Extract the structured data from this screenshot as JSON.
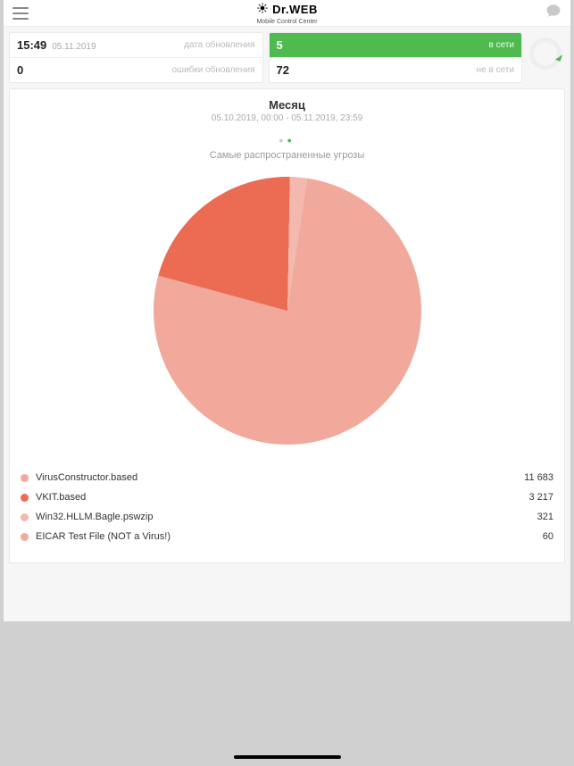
{
  "brand": {
    "name": "Dr.WEB",
    "subtitle": "Mobile Control Center"
  },
  "stats": {
    "update": {
      "time": "15:49",
      "date": "05.11.2019",
      "label": "дата обновления"
    },
    "errors": {
      "value": "0",
      "label": "ошибки обновления"
    },
    "online": {
      "value": "5",
      "label": "в сети"
    },
    "offline": {
      "value": "72",
      "label": "не в сети"
    }
  },
  "period": {
    "title": "Месяц",
    "range": "05.10.2019, 00:00 - 05.11.2019, 23:59"
  },
  "chart_title": "Самые распространенные угрозы",
  "chart_data": {
    "type": "pie",
    "title": "Самые распространенные угрозы",
    "series": [
      {
        "name": "VirusConstructor.based",
        "value": 11683,
        "display": "11 683",
        "color": "#f1a99c"
      },
      {
        "name": "VKIT.based",
        "value": 3217,
        "display": "3 217",
        "color": "#ec6b53"
      },
      {
        "name": "Win32.HLLM.Bagle.pswzip",
        "value": 321,
        "display": "321",
        "color": "#f3b9af"
      },
      {
        "name": "EICAR Test File (NOT a Virus!)",
        "value": 60,
        "display": "60",
        "color": "#f1a99c"
      }
    ]
  }
}
